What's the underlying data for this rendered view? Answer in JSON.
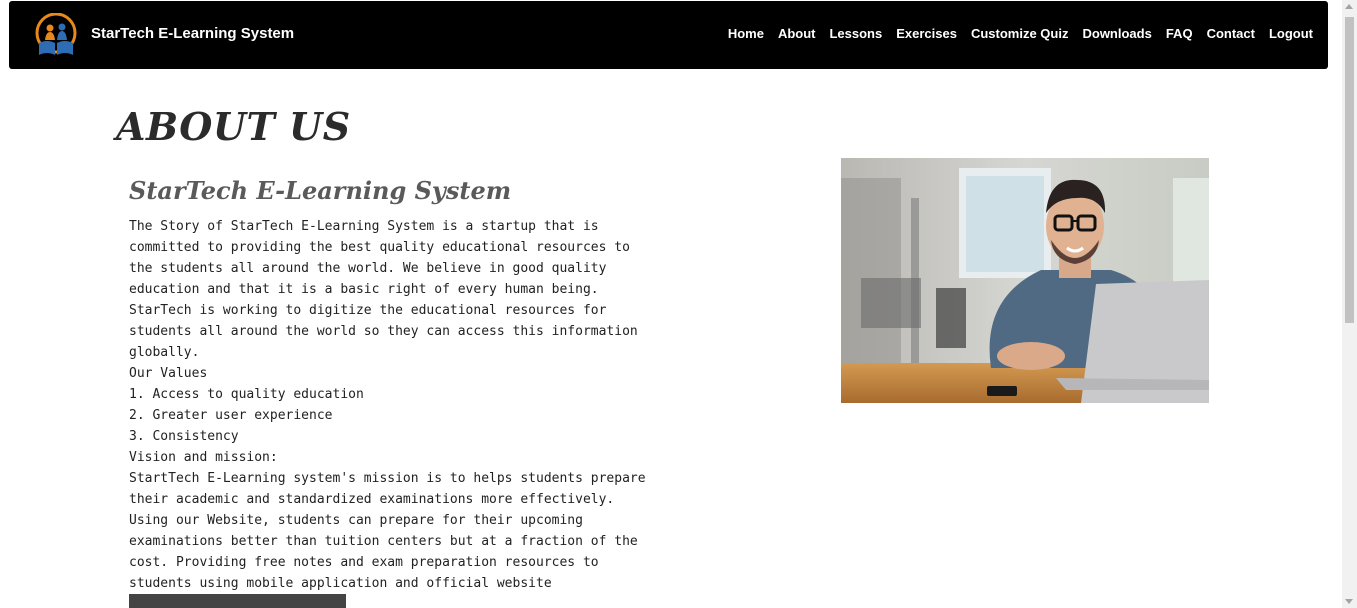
{
  "header": {
    "brand_name": "StarTech E-Learning System",
    "logo_icon": "book-student-logo",
    "nav": [
      {
        "label": "Home"
      },
      {
        "label": "About"
      },
      {
        "label": "Lessons"
      },
      {
        "label": "Exercises"
      },
      {
        "label": "Customize Quiz"
      },
      {
        "label": "Downloads"
      },
      {
        "label": "FAQ"
      },
      {
        "label": "Contact"
      },
      {
        "label": "Logout"
      }
    ]
  },
  "main": {
    "page_title": "ABOUT US",
    "section_title": "StarTech E-Learning System",
    "story": "The Story of StarTech E-Learning System is a startup that is committed to providing the best quality educational resources to the students all around the world. We believe in good quality education and that it is a basic right of every human being. StarTech is working to digitize the educational resources for students all around the world so they can access this information globally.",
    "values_heading": "Our Values",
    "values": [
      "1. Access to quality education",
      "2. Greater user experience",
      "3. Consistency"
    ],
    "vision_heading": "Vision and mission:",
    "vision_text": "StartTech E-Learning system's mission is to helps students prepare their academic and standardized examinations more effectively. Using our Website, students can prepare for their upcoming examinations better than tuition centers but at a fraction of the cost. Providing free notes and exam preparation resources to students using mobile application and official website",
    "image_subject": "man-with-glasses-smiling-at-laptop-photo"
  },
  "colors": {
    "navbar_bg": "#000000",
    "accent_orange": "#e8891c",
    "logo_blue": "#2e6db4",
    "title_text": "#2b2b2b",
    "subtitle_text": "#5a5a5a",
    "button_bg": "#444444"
  }
}
